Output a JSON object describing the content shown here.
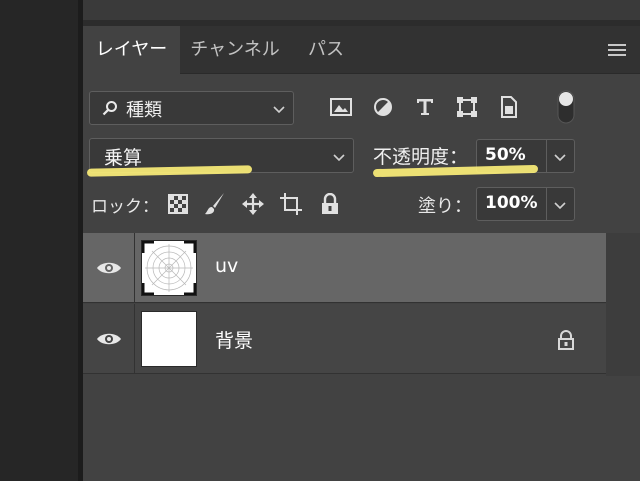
{
  "tabs": [
    {
      "label": "レイヤー",
      "active": true
    },
    {
      "label": "チャンネル",
      "active": false
    },
    {
      "label": "パス",
      "active": false
    }
  ],
  "filter": {
    "kind_label": "種類",
    "icons": [
      "image-filter-icon",
      "adjustment-filter-icon",
      "type-filter-icon",
      "shape-filter-icon",
      "smart-object-filter-icon"
    ]
  },
  "blend": {
    "mode": "乗算",
    "opacity_label": "不透明度：",
    "opacity_value": "50%"
  },
  "lock": {
    "label": "ロック：",
    "icons": [
      "lock-transparent-pixels-icon",
      "lock-image-pixels-icon",
      "lock-position-icon",
      "lock-artboard-icon",
      "lock-all-icon"
    ],
    "fill_label": "塗り：",
    "fill_value": "100%"
  },
  "layers": [
    {
      "name": "uv",
      "selected": true,
      "visible": true,
      "locked": false
    },
    {
      "name": "背景",
      "selected": false,
      "visible": true,
      "locked": true
    }
  ],
  "colors": {
    "highlight": "#fff27a",
    "selected_row": "#666666",
    "panel": "#424242"
  }
}
